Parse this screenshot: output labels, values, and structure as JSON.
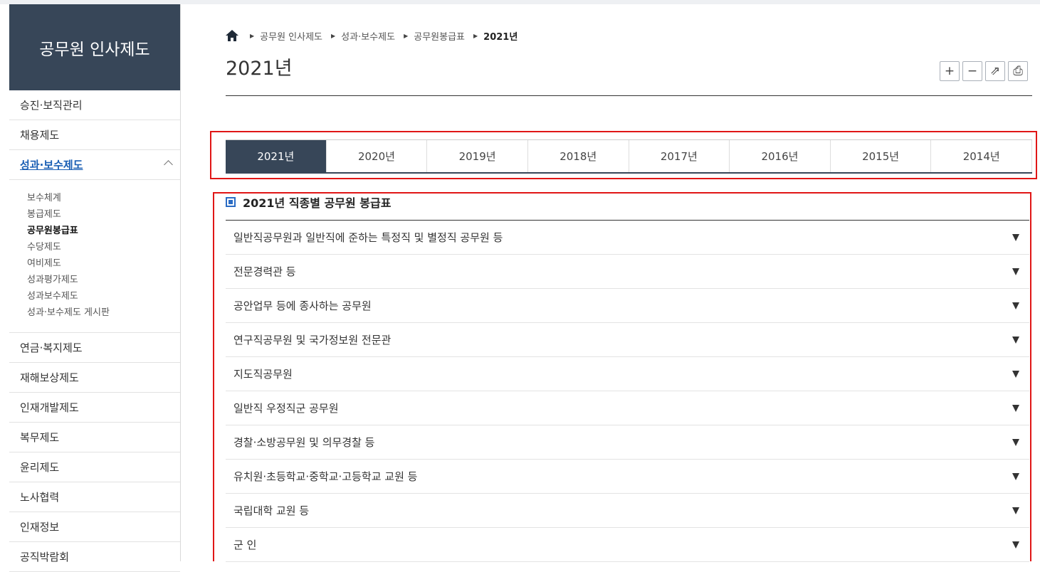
{
  "sidebar": {
    "title": "공무원 인사제도",
    "items_top": [
      {
        "label": "승진·보직관리"
      },
      {
        "label": "채용제도"
      },
      {
        "label": "성과·보수제도"
      }
    ],
    "sub_items": [
      {
        "label": "보수체계"
      },
      {
        "label": "봉급제도"
      },
      {
        "label": "공무원봉급표"
      },
      {
        "label": "수당제도"
      },
      {
        "label": "여비제도"
      },
      {
        "label": "성과평가제도"
      },
      {
        "label": "성과보수제도"
      },
      {
        "label": "성과·보수제도 게시판"
      }
    ],
    "items_bottom": [
      {
        "label": "연금·복지제도"
      },
      {
        "label": "재해보상제도"
      },
      {
        "label": "인재개발제도"
      },
      {
        "label": "복무제도"
      },
      {
        "label": "윤리제도"
      },
      {
        "label": "노사협력"
      },
      {
        "label": "인재정보"
      },
      {
        "label": "공직박람회"
      }
    ]
  },
  "breadcrumb": [
    "공무원 인사제도",
    "성과·보수제도",
    "공무원봉급표",
    "2021년"
  ],
  "page_title": "2021년",
  "tools": {
    "zoom_in": "+",
    "zoom_out": "−",
    "share": "⇗",
    "print": "⎙"
  },
  "year_tabs": [
    "2021년",
    "2020년",
    "2019년",
    "2018년",
    "2017년",
    "2016년",
    "2015년",
    "2014년"
  ],
  "active_tab": "2021년",
  "section_title": "2021년 직종별 공무원 봉급표",
  "accordion": [
    "일반직공무원과 일반직에 준하는 특정직 및 별정직 공무원 등",
    "전문경력관 등",
    "공안업무 등에 종사하는 공무원",
    "연구직공무원 및 국가정보원 전문관",
    "지도직공무원",
    "일반직 우정직군 공무원",
    "경찰·소방공무원 및 의무경찰 등",
    "유치원·초등학교·중학교·고등학교 교원 등",
    "국립대학 교원 등",
    "군 인"
  ],
  "colors": {
    "sidebar_header": "#374658",
    "active_link": "#1a5fb4",
    "highlight_box": "#e01616",
    "section_icon": "#2b6cc4"
  }
}
